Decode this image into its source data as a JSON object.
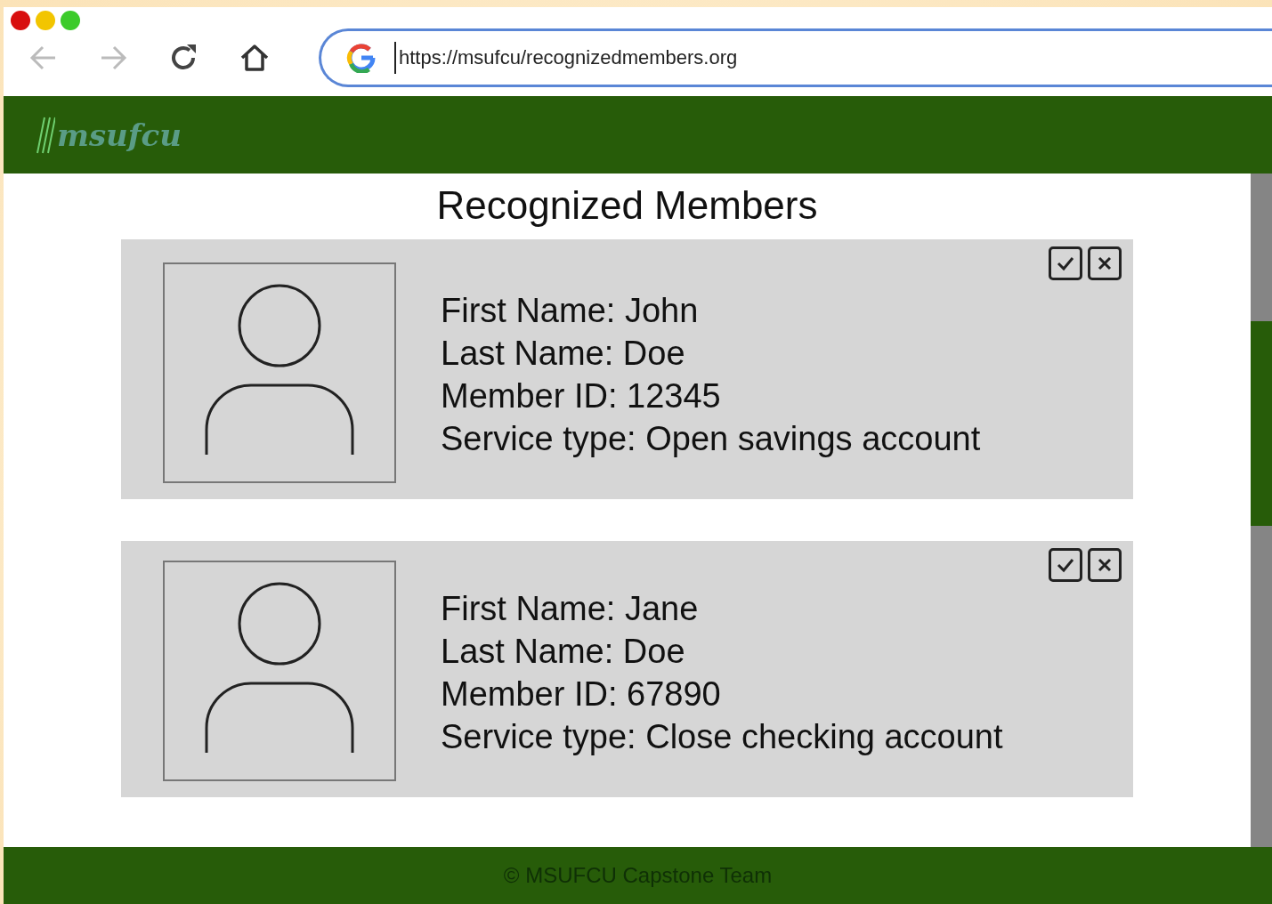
{
  "browser": {
    "url": "https://msufcu/recognizedmembers.org"
  },
  "header": {
    "logo": "msufcu"
  },
  "page_title": "Recognized Members",
  "members": [
    {
      "fields": [
        "First Name: John",
        "Last Name: Doe",
        "Member ID: 12345",
        "Service type: Open savings account"
      ]
    },
    {
      "fields": [
        "First Name: Jane",
        "Last Name: Doe",
        "Member ID: 67890",
        "Service type: Close checking account"
      ]
    }
  ],
  "footer": {
    "text": "© MSUFCU Capstone Team"
  }
}
